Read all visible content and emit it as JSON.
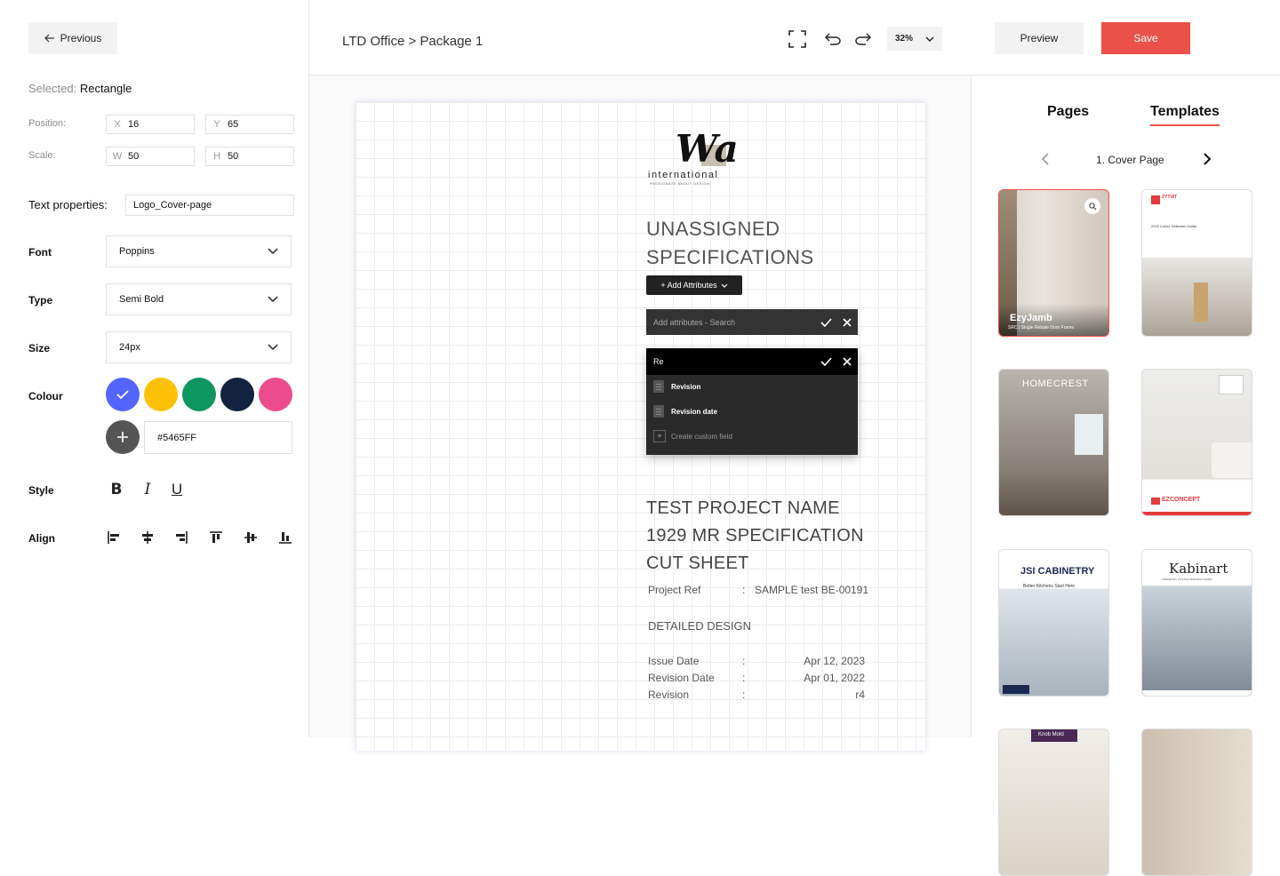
{
  "left_panel": {
    "previous_label": "Previous",
    "selected_label": "Selected:",
    "selected_value": "Rectangle",
    "position_label": "Position:",
    "scale_label": "Scale:",
    "x_axis": "X",
    "x_value": "16",
    "y_axis": "Y",
    "y_value": "65",
    "w_axis": "W",
    "w_value": "50",
    "h_axis": "H",
    "h_value": "50",
    "text_props_label": "Text properties:",
    "text_props_value": "Logo_Cover-page",
    "font_label": "Font",
    "font_value": "Poppins",
    "type_label": "Type",
    "type_value": "Semi Bold",
    "size_label": "Size",
    "size_value": "24px",
    "colour_label": "Colour",
    "swatches": [
      "#5465FF",
      "#FFC107",
      "#0E9660",
      "#13233F",
      "#EC4C8B"
    ],
    "hex_value": "#5465FF",
    "style_label": "Style",
    "align_label": "Align",
    "bold_glyph": "B",
    "italic_glyph": "I",
    "underline_glyph": "U"
  },
  "topbar": {
    "breadcrumb": "LTD Office > Package 1",
    "zoom": "32%",
    "preview_label": "Preview",
    "save_label": "Save",
    "accent": "#EA5148"
  },
  "canvas": {
    "logo_mark": "Wa",
    "logo_text": "international",
    "logo_tagline": "PASSIONATE ABOUT DESIGN",
    "title_line1": "UNASSIGNED",
    "title_line2": "SPECIFICATIONS",
    "add_attr_label": "+ Add Attributes",
    "search_placeholder": "Add attributes - Search",
    "dropdown_query": "Re",
    "dropdown_items": [
      "Revision",
      "Revision date"
    ],
    "custom_field_label": "Create custom field",
    "project_line1": "TEST PROJECT NAME",
    "project_line2": "1929 MR SPECIFICATION",
    "project_line3": "CUT SHEET",
    "project_ref_label": "Project Ref",
    "project_ref_value": "SAMPLE test BE-00191",
    "detailed_design": "DETAILED DESIGN",
    "issue_date_label": "Issue Date",
    "issue_date_value": "Apr 12, 2023",
    "revision_date_label": "Revision Date",
    "revision_date_value": "Apr 01, 2022",
    "revision_label": "Revision",
    "revision_value": "r4",
    "colon": ":"
  },
  "right_panel": {
    "tab_pages": "Pages",
    "tab_templates": "Templates",
    "current_page": "1. Cover Page",
    "thumbs": {
      "t1_brand": "EzyJamb",
      "t1_sub": "SRC | Single Rebate Door Frame",
      "t2_brand": "ZYTIAT",
      "t2_sub": "2023 Colour Selection Guide",
      "t3_brand": "HOMECREST",
      "t4_brand": "EZCONCEPT",
      "t5_brand": "JSI CABINETRY",
      "t5_sub": "Better Kitchens Start Here",
      "t6_brand": "Kabinart",
      "t6_sub": "CABINETRY CUSTOM MANUFACTURED",
      "t7_brand": "Knob Mold"
    }
  }
}
